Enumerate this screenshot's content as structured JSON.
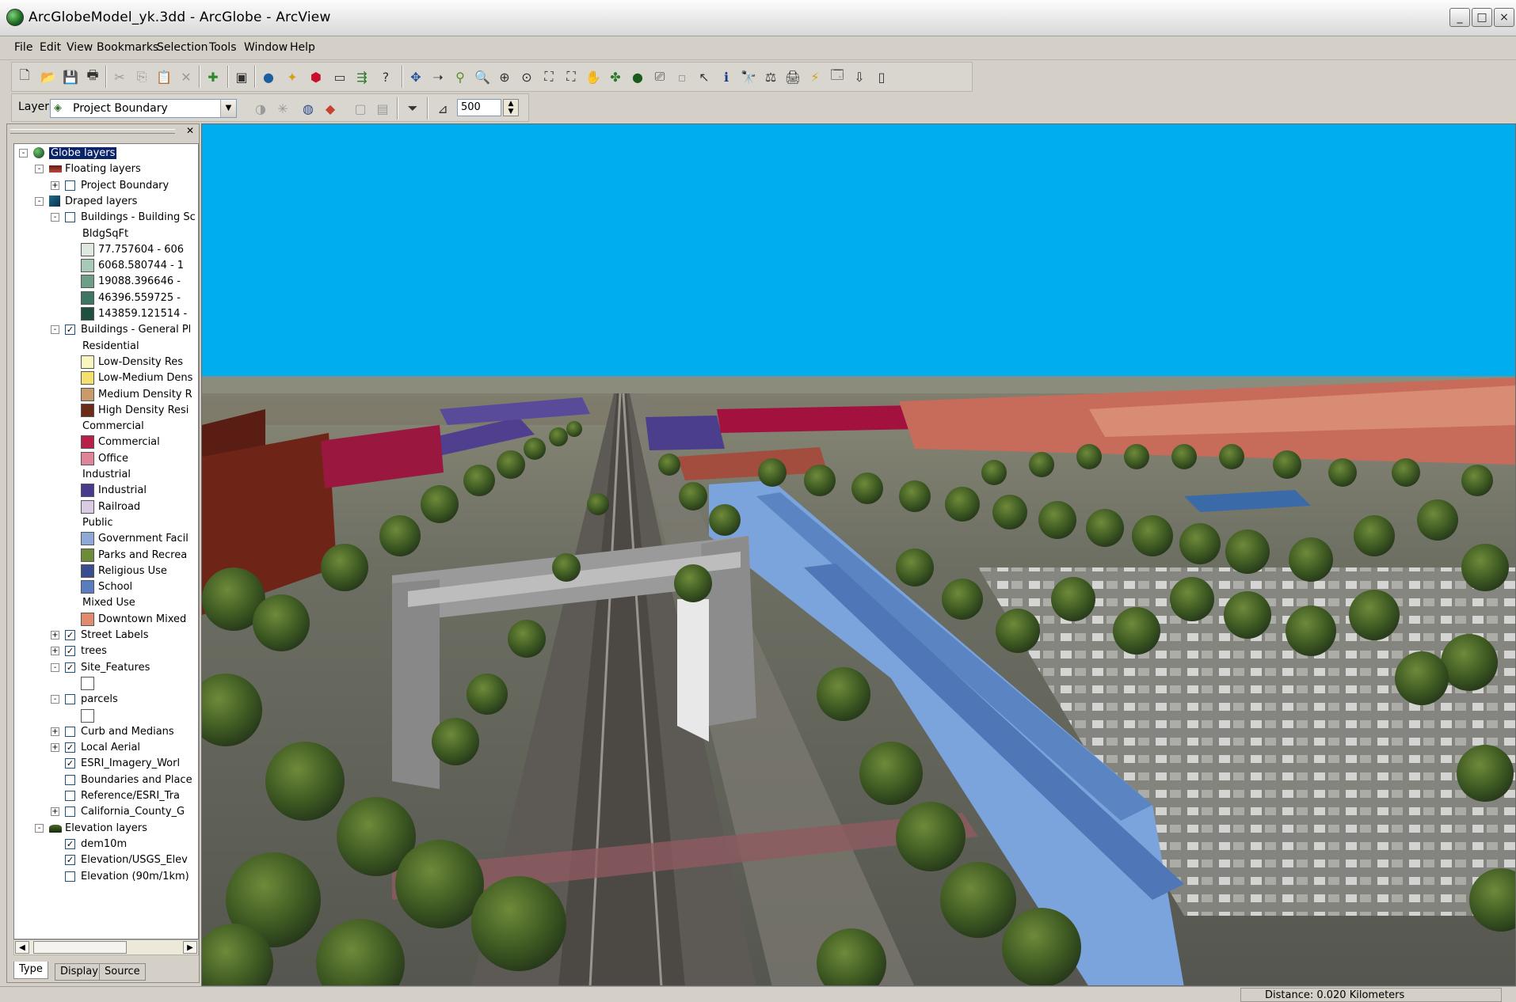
{
  "window": {
    "title": "ArcGlobeModel_yk.3dd - ArcGlobe - ArcView",
    "controls": {
      "minimize": "_",
      "maximize": "□",
      "close": "×"
    }
  },
  "menu": [
    "File",
    "Edit",
    "View",
    "Bookmarks",
    "Selection",
    "Tools",
    "Window",
    "Help"
  ],
  "toolbar2": {
    "layer_label": "Layer:",
    "layer_value": "Project Boundary",
    "scale_value": "500"
  },
  "toc": {
    "rows": [
      {
        "label": "Globe layers",
        "indent": 0,
        "expander": "-",
        "icon": "globe-icon",
        "selected": true
      },
      {
        "label": "Floating layers",
        "indent": 1,
        "expander": "-",
        "icon": "floating-layers-icon"
      },
      {
        "label": "Project Boundary",
        "indent": 2,
        "expander": "+",
        "check": false
      },
      {
        "label": "Draped layers",
        "indent": 1,
        "expander": "-",
        "icon": "draped-layers-icon"
      },
      {
        "label": "Buildings - Building Sc",
        "indent": 2,
        "expander": "-",
        "check": false
      },
      {
        "label": "BldgSqFt",
        "indent": 3,
        "kind": "heading"
      },
      {
        "label": "77.757604 - 606",
        "indent": 3,
        "swatch": "#dde9e0"
      },
      {
        "label": "6068.580744 - 1",
        "indent": 3,
        "swatch": "#a9c8b6"
      },
      {
        "label": "19088.396646 - ",
        "indent": 3,
        "swatch": "#6e9e88"
      },
      {
        "label": "46396.559725 - ",
        "indent": 3,
        "swatch": "#3f7663"
      },
      {
        "label": "143859.121514 -",
        "indent": 3,
        "swatch": "#1f4f40"
      },
      {
        "label": "Buildings - General Pl",
        "indent": 2,
        "expander": "-",
        "check": true
      },
      {
        "label": "Residential",
        "indent": 3,
        "kind": "heading"
      },
      {
        "label": "Low-Density Res",
        "indent": 3,
        "swatch": "#fbf6bf"
      },
      {
        "label": "Low-Medium Dens",
        "indent": 3,
        "swatch": "#f5df6e"
      },
      {
        "label": "Medium Density R",
        "indent": 3,
        "swatch": "#c89a6c"
      },
      {
        "label": "High Density Resi",
        "indent": 3,
        "swatch": "#6e2a18"
      },
      {
        "label": "Commercial",
        "indent": 3,
        "kind": "heading"
      },
      {
        "label": "Commercial",
        "indent": 3,
        "swatch": "#b8204a"
      },
      {
        "label": "Office",
        "indent": 3,
        "swatch": "#e0849a"
      },
      {
        "label": "Industrial",
        "indent": 3,
        "kind": "heading"
      },
      {
        "label": "Industrial",
        "indent": 3,
        "swatch": "#4a3a8e"
      },
      {
        "label": "Railroad",
        "indent": 3,
        "swatch": "#d8cbe3"
      },
      {
        "label": "Public",
        "indent": 3,
        "kind": "heading"
      },
      {
        "label": "Government Facil",
        "indent": 3,
        "swatch": "#90a8d6"
      },
      {
        "label": "Parks and Recrea",
        "indent": 3,
        "swatch": "#6e8b3a"
      },
      {
        "label": "Religious Use",
        "indent": 3,
        "swatch": "#3a4e8e"
      },
      {
        "label": "School",
        "indent": 3,
        "swatch": "#5a7dc0"
      },
      {
        "label": "Mixed Use",
        "indent": 3,
        "kind": "heading"
      },
      {
        "label": "Downtown Mixed",
        "indent": 3,
        "swatch": "#e08a6e"
      },
      {
        "label": "Street Labels",
        "indent": 2,
        "expander": "+",
        "check": true
      },
      {
        "label": "trees",
        "indent": 2,
        "expander": "+",
        "check": true
      },
      {
        "label": "Site_Features",
        "indent": 2,
        "expander": "-",
        "check": true
      },
      {
        "label": "",
        "indent": 3,
        "swatch": "#ffffff"
      },
      {
        "label": "parcels",
        "indent": 2,
        "expander": "-",
        "check": false
      },
      {
        "label": "",
        "indent": 3,
        "swatch": "#ffffff"
      },
      {
        "label": "Curb and Medians",
        "indent": 2,
        "expander": "+",
        "check": false
      },
      {
        "label": "Local Aerial",
        "indent": 2,
        "expander": "+",
        "check": true
      },
      {
        "label": "ESRI_Imagery_Worl",
        "indent": 2,
        "check": true
      },
      {
        "label": "Boundaries and Place",
        "indent": 2,
        "check": false
      },
      {
        "label": "Reference/ESRI_Tra",
        "indent": 2,
        "check": false
      },
      {
        "label": "California_County_G",
        "indent": 2,
        "expander": "+",
        "check": false
      },
      {
        "label": "Elevation layers",
        "indent": 1,
        "expander": "-",
        "icon": "elevation-layers-icon"
      },
      {
        "label": "dem10m",
        "indent": 2,
        "check": true
      },
      {
        "label": "Elevation/USGS_Elev",
        "indent": 2,
        "check": true
      },
      {
        "label": "Elevation (90m/1km)",
        "indent": 2,
        "check": false
      }
    ],
    "tabs": [
      "Type",
      "Display",
      "Source"
    ]
  },
  "status": {
    "distance": "Distance:  0.020 Kilometers"
  }
}
